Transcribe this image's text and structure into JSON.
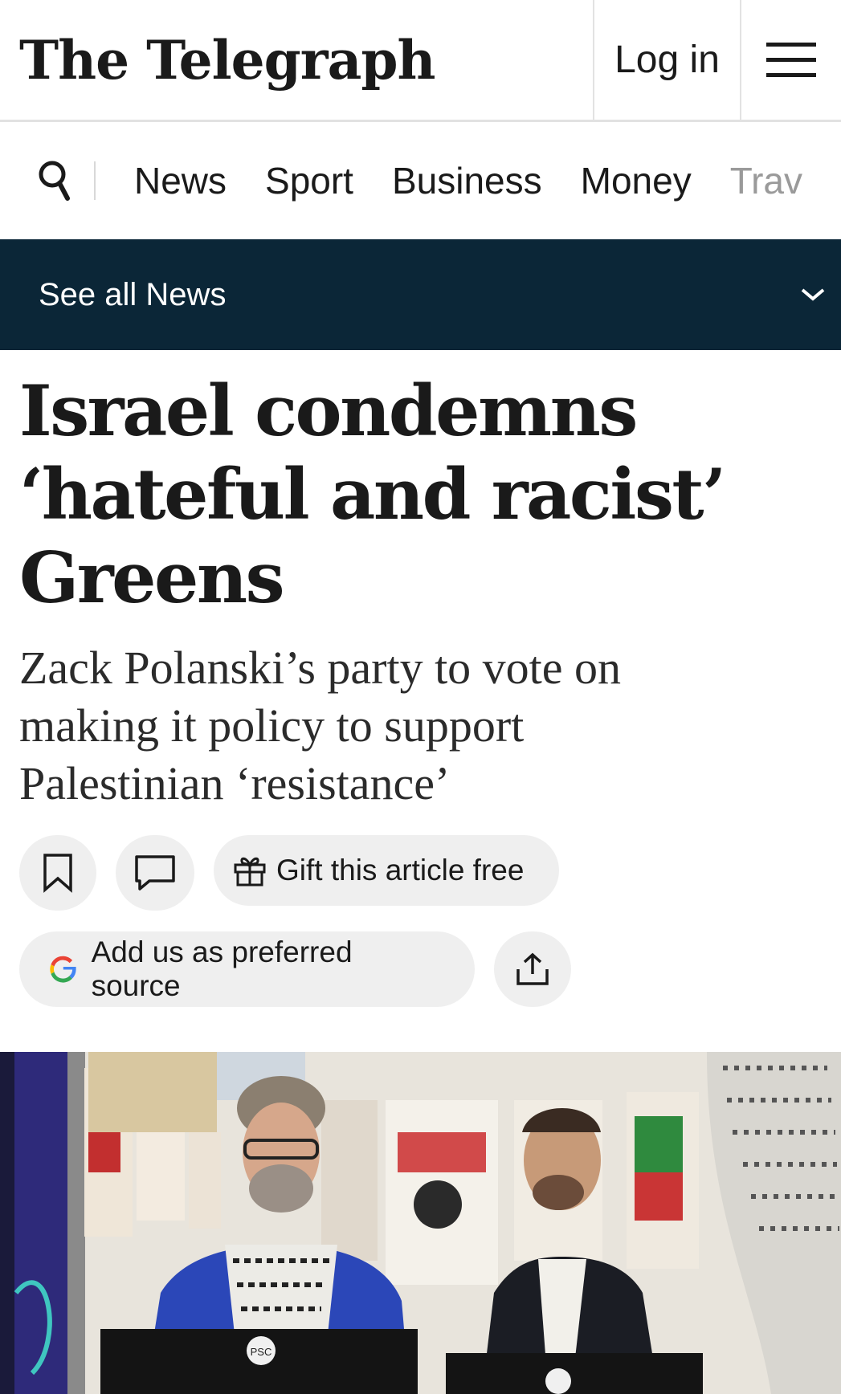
{
  "header": {
    "logo_text": "The Telegraph",
    "login_label": "Log in",
    "menu_icon": "hamburger-menu-icon"
  },
  "nav": {
    "search_icon": "search-icon",
    "items": [
      {
        "label": "News"
      },
      {
        "label": "Sport"
      },
      {
        "label": "Business"
      },
      {
        "label": "Money"
      },
      {
        "label": "Trav"
      }
    ]
  },
  "section_bar": {
    "label": "See all News",
    "icon": "chevron-down-icon",
    "color": "#0b2637"
  },
  "article": {
    "headline_lines": [
      "Israel condemns",
      "‘hateful and racist’",
      "Greens"
    ],
    "standfirst_lines": [
      "Zack Polanski’s party to vote on",
      "making it policy to support",
      "Palestinian ‘resistance’"
    ]
  },
  "actions": {
    "bookmark_icon": "bookmark-icon",
    "comment_icon": "comment-icon",
    "gift_label": "Gift this article free",
    "gift_icon": "gift-icon",
    "source_label": "Add us as preferred source",
    "source_icon": "google-icon",
    "share_icon": "share-icon"
  },
  "photo": {
    "badge_text": "PSC"
  }
}
